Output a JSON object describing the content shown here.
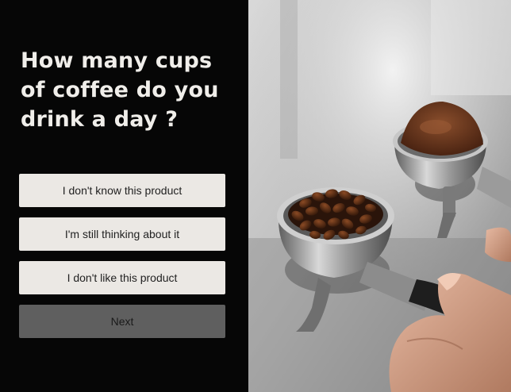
{
  "question": {
    "title": "How many cups of coffee do you drink a day ?"
  },
  "options": [
    {
      "label": "I don't know this product"
    },
    {
      "label": "I'm still thinking about it"
    },
    {
      "label": "I don't like this product"
    }
  ],
  "actions": {
    "next_label": "Next"
  },
  "image": {
    "icon": "coffee-portafilter-photo"
  },
  "colors": {
    "panel_background": "#060606",
    "title_text": "#f0eeea",
    "option_background": "#ebe8e4",
    "next_background": "#5f5f5f"
  }
}
